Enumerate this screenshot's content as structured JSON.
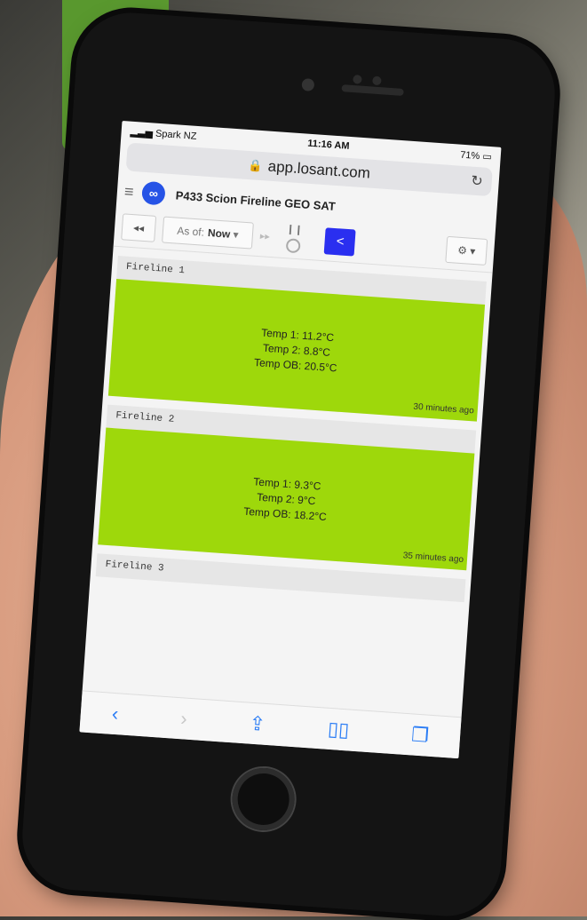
{
  "status_bar": {
    "carrier": "Spark NZ",
    "time": "11:16 AM",
    "battery": "71%"
  },
  "browser": {
    "url": "app.losant.com"
  },
  "app": {
    "title": "P433 Scion Fireline GEO SAT"
  },
  "toolbar": {
    "as_of_label": "As of:",
    "as_of_value": "Now"
  },
  "blocks": [
    {
      "label": "Fireline 1",
      "lines": [
        "Temp 1: 11.2°C",
        "Temp 2: 8.8°C",
        "Temp OB: 20.5°C"
      ],
      "updated": "30 minutes ago"
    },
    {
      "label": "Fireline 2",
      "lines": [
        "Temp 1: 9.3°C",
        "Temp 2: 9°C",
        "Temp OB: 18.2°C"
      ],
      "updated": "35 minutes ago"
    },
    {
      "label": "Fireline 3"
    }
  ],
  "colors": {
    "tile": "#9ed80b",
    "share_button": "#2a2ff0",
    "logo": "#2653e6"
  }
}
